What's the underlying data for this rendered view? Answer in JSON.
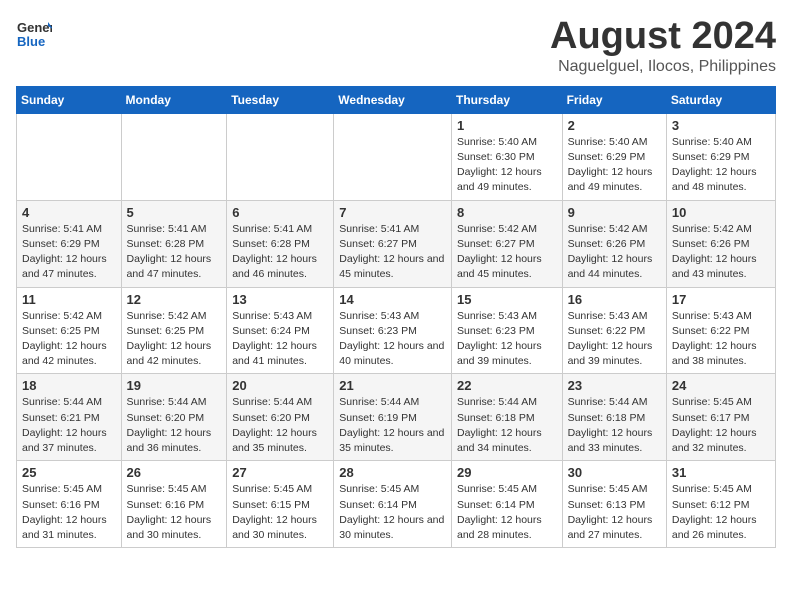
{
  "logo": {
    "general": "General",
    "blue": "Blue"
  },
  "title": "August 2024",
  "subtitle": "Naguelguel, Ilocos, Philippines",
  "days_header": [
    "Sunday",
    "Monday",
    "Tuesday",
    "Wednesday",
    "Thursday",
    "Friday",
    "Saturday"
  ],
  "weeks": [
    [
      {
        "day": "",
        "content": ""
      },
      {
        "day": "",
        "content": ""
      },
      {
        "day": "",
        "content": ""
      },
      {
        "day": "",
        "content": ""
      },
      {
        "day": "1",
        "content": "Sunrise: 5:40 AM\nSunset: 6:30 PM\nDaylight: 12 hours and 49 minutes."
      },
      {
        "day": "2",
        "content": "Sunrise: 5:40 AM\nSunset: 6:29 PM\nDaylight: 12 hours and 49 minutes."
      },
      {
        "day": "3",
        "content": "Sunrise: 5:40 AM\nSunset: 6:29 PM\nDaylight: 12 hours and 48 minutes."
      }
    ],
    [
      {
        "day": "4",
        "content": "Sunrise: 5:41 AM\nSunset: 6:29 PM\nDaylight: 12 hours and 47 minutes."
      },
      {
        "day": "5",
        "content": "Sunrise: 5:41 AM\nSunset: 6:28 PM\nDaylight: 12 hours and 47 minutes."
      },
      {
        "day": "6",
        "content": "Sunrise: 5:41 AM\nSunset: 6:28 PM\nDaylight: 12 hours and 46 minutes."
      },
      {
        "day": "7",
        "content": "Sunrise: 5:41 AM\nSunset: 6:27 PM\nDaylight: 12 hours and 45 minutes."
      },
      {
        "day": "8",
        "content": "Sunrise: 5:42 AM\nSunset: 6:27 PM\nDaylight: 12 hours and 45 minutes."
      },
      {
        "day": "9",
        "content": "Sunrise: 5:42 AM\nSunset: 6:26 PM\nDaylight: 12 hours and 44 minutes."
      },
      {
        "day": "10",
        "content": "Sunrise: 5:42 AM\nSunset: 6:26 PM\nDaylight: 12 hours and 43 minutes."
      }
    ],
    [
      {
        "day": "11",
        "content": "Sunrise: 5:42 AM\nSunset: 6:25 PM\nDaylight: 12 hours and 42 minutes."
      },
      {
        "day": "12",
        "content": "Sunrise: 5:42 AM\nSunset: 6:25 PM\nDaylight: 12 hours and 42 minutes."
      },
      {
        "day": "13",
        "content": "Sunrise: 5:43 AM\nSunset: 6:24 PM\nDaylight: 12 hours and 41 minutes."
      },
      {
        "day": "14",
        "content": "Sunrise: 5:43 AM\nSunset: 6:23 PM\nDaylight: 12 hours and 40 minutes."
      },
      {
        "day": "15",
        "content": "Sunrise: 5:43 AM\nSunset: 6:23 PM\nDaylight: 12 hours and 39 minutes."
      },
      {
        "day": "16",
        "content": "Sunrise: 5:43 AM\nSunset: 6:22 PM\nDaylight: 12 hours and 39 minutes."
      },
      {
        "day": "17",
        "content": "Sunrise: 5:43 AM\nSunset: 6:22 PM\nDaylight: 12 hours and 38 minutes."
      }
    ],
    [
      {
        "day": "18",
        "content": "Sunrise: 5:44 AM\nSunset: 6:21 PM\nDaylight: 12 hours and 37 minutes."
      },
      {
        "day": "19",
        "content": "Sunrise: 5:44 AM\nSunset: 6:20 PM\nDaylight: 12 hours and 36 minutes."
      },
      {
        "day": "20",
        "content": "Sunrise: 5:44 AM\nSunset: 6:20 PM\nDaylight: 12 hours and 35 minutes."
      },
      {
        "day": "21",
        "content": "Sunrise: 5:44 AM\nSunset: 6:19 PM\nDaylight: 12 hours and 35 minutes."
      },
      {
        "day": "22",
        "content": "Sunrise: 5:44 AM\nSunset: 6:18 PM\nDaylight: 12 hours and 34 minutes."
      },
      {
        "day": "23",
        "content": "Sunrise: 5:44 AM\nSunset: 6:18 PM\nDaylight: 12 hours and 33 minutes."
      },
      {
        "day": "24",
        "content": "Sunrise: 5:45 AM\nSunset: 6:17 PM\nDaylight: 12 hours and 32 minutes."
      }
    ],
    [
      {
        "day": "25",
        "content": "Sunrise: 5:45 AM\nSunset: 6:16 PM\nDaylight: 12 hours and 31 minutes."
      },
      {
        "day": "26",
        "content": "Sunrise: 5:45 AM\nSunset: 6:16 PM\nDaylight: 12 hours and 30 minutes."
      },
      {
        "day": "27",
        "content": "Sunrise: 5:45 AM\nSunset: 6:15 PM\nDaylight: 12 hours and 30 minutes."
      },
      {
        "day": "28",
        "content": "Sunrise: 5:45 AM\nSunset: 6:14 PM\nDaylight: 12 hours and 30 minutes."
      },
      {
        "day": "29",
        "content": "Sunrise: 5:45 AM\nSunset: 6:14 PM\nDaylight: 12 hours and 28 minutes."
      },
      {
        "day": "30",
        "content": "Sunrise: 5:45 AM\nSunset: 6:13 PM\nDaylight: 12 hours and 27 minutes."
      },
      {
        "day": "31",
        "content": "Sunrise: 5:45 AM\nSunset: 6:12 PM\nDaylight: 12 hours and 26 minutes."
      }
    ]
  ]
}
